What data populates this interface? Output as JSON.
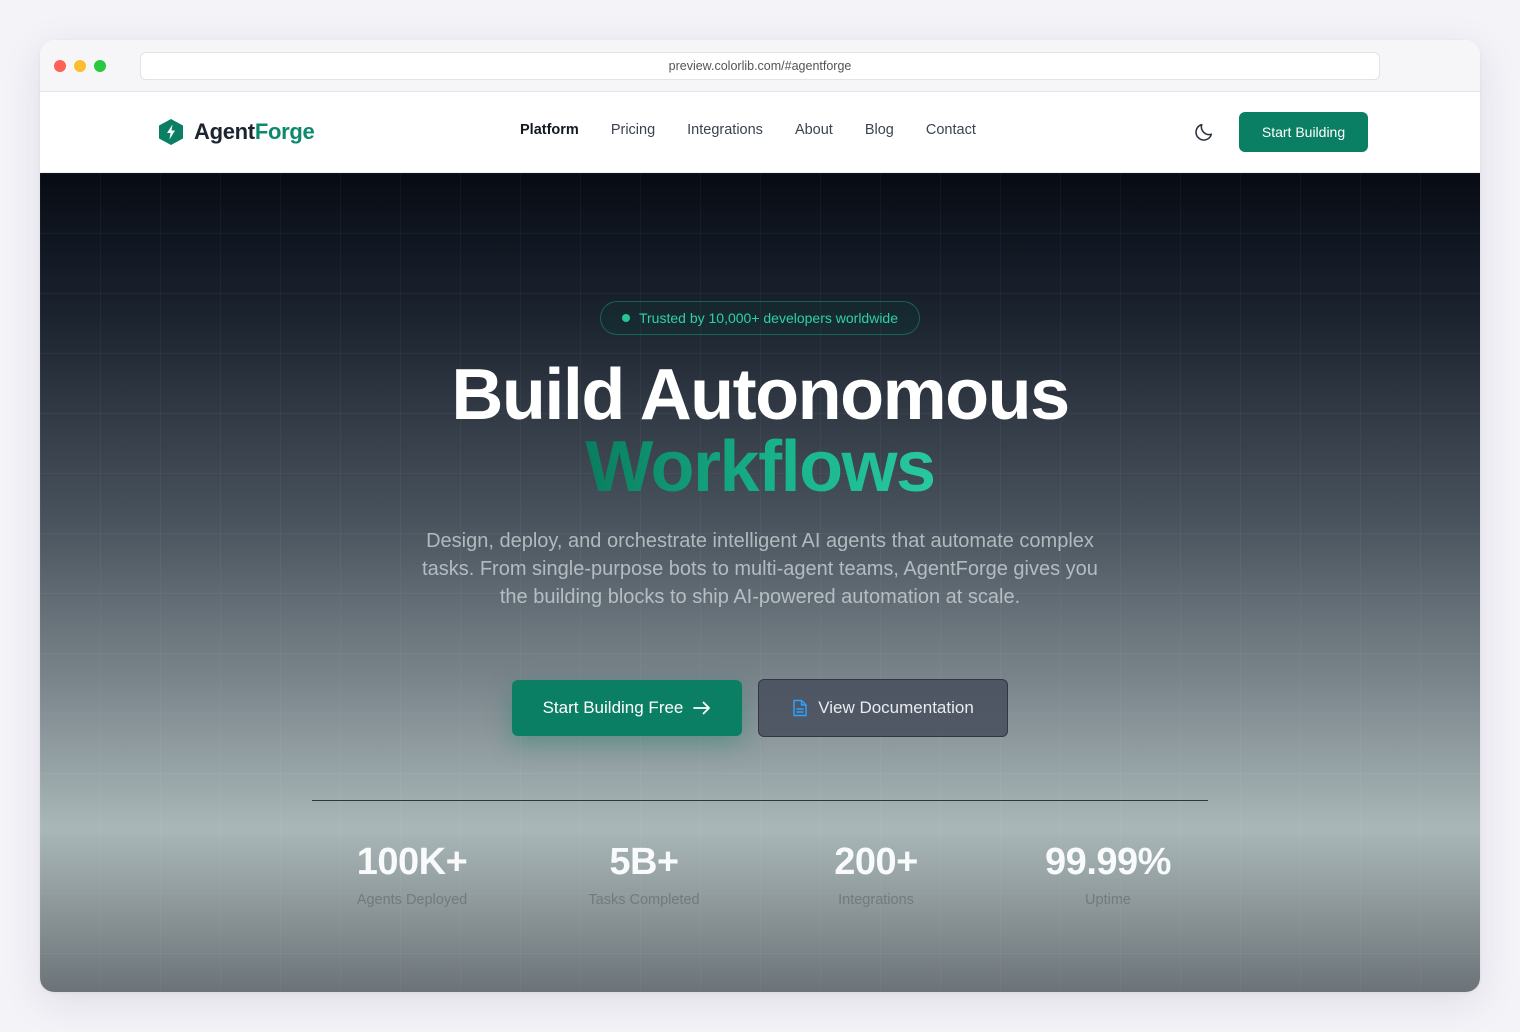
{
  "browser": {
    "url": "preview.colorlib.com/#agentforge"
  },
  "nav": {
    "logo_primary": "Agent",
    "logo_accent": "Forge",
    "items": [
      {
        "label": "Platform",
        "active": true
      },
      {
        "label": "Pricing",
        "active": false
      },
      {
        "label": "Integrations",
        "active": false
      },
      {
        "label": "About",
        "active": false
      },
      {
        "label": "Blog",
        "active": false
      },
      {
        "label": "Contact",
        "active": false
      }
    ],
    "cta_label": "Start Building",
    "theme_icon": "moon-icon"
  },
  "hero": {
    "badge": "Trusted by 10,000+ developers worldwide",
    "headline": "Build Autonomous",
    "headline_accent": "Workflows",
    "subtitle": "Design, deploy, and orchestrate intelligent AI agents that automate complex tasks. From single-purpose bots to multi-agent teams, AgentForge gives you the building blocks to ship AI-powered automation at scale.",
    "primary_cta": "Start Building Free",
    "secondary_cta": "View Documentation"
  },
  "stats": [
    {
      "value": "100K+",
      "label": "Agents Deployed"
    },
    {
      "value": "5B+",
      "label": "Tasks Completed"
    },
    {
      "value": "200+",
      "label": "Integrations"
    },
    {
      "value": "99.99%",
      "label": "Uptime"
    }
  ],
  "colors": {
    "brand": "#0b7f64",
    "accent_text": "#2ed1a3",
    "hero_dark": "#070b14"
  }
}
